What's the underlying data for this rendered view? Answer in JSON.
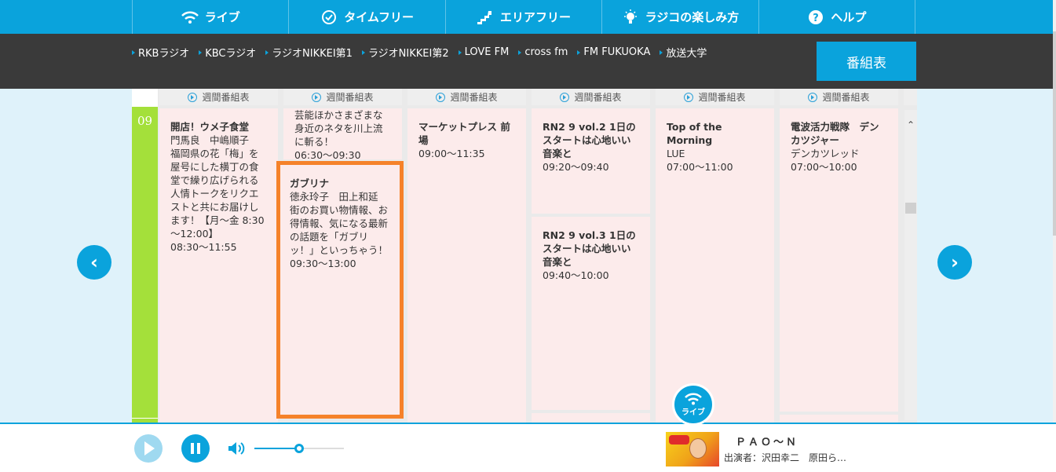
{
  "nav": {
    "items": [
      {
        "label": "ライブ",
        "icon": "wifi-icon"
      },
      {
        "label": "タイムフリー",
        "icon": "check-circle-icon"
      },
      {
        "label": "エリアフリー",
        "icon": "map-icon"
      },
      {
        "label": "ラジコの楽しみ方",
        "icon": "lightbulb-icon"
      },
      {
        "label": "ヘルプ",
        "icon": "help-icon"
      }
    ]
  },
  "stations": [
    "RKBラジオ",
    "KBCラジオ",
    "ラジオNIKKEI第1",
    "ラジオNIKKEI第2",
    "LOVE FM",
    "cross fm",
    "FM FUKUOKA",
    "放送大学"
  ],
  "schedule_button": "番組表",
  "weekly_label": "週間番組表",
  "time": {
    "hour": "09"
  },
  "programs": {
    "c1p1": {
      "title": "開店！ウメ子食堂",
      "desc": "門馬良　中嶋順子　福岡県の花「梅」を屋号にした横丁の食堂で繰り広げられる人情トークをリクエストと共にお届けします！【月～金 8:30～12:00】",
      "time": "08:30～11:55"
    },
    "c2p1": {
      "title": "",
      "desc": "芸能ほかさまざまな身近のネタを川上流に斬る！",
      "time": "06:30～09:30"
    },
    "c2p2": {
      "title": "ガブリナ",
      "desc": "徳永玲子　田上和延　街のお買い物情報、お得情報、気になる最新の話題を「ガブリッ！」といっちゃう！",
      "time": "09:30～13:00"
    },
    "c3p1": {
      "title": "マーケットプレス 前場",
      "desc": "",
      "time": "09:00～11:35"
    },
    "c4p1": {
      "title": "RN2 9 vol.2 1日のスタートは心地いい音楽と",
      "desc": "",
      "time": "09:20～09:40"
    },
    "c4p2": {
      "title": "RN2 9 vol.3 1日のスタートは心地いい音楽と",
      "desc": "",
      "time": "09:40～10:00"
    },
    "c5p1": {
      "title": "Top of the Morning",
      "desc": "LUE",
      "time": "07:00～11:00"
    },
    "c6p1": {
      "title": "電波活力戦隊　デンカツジャー",
      "desc": "デンカツレッド",
      "time": "07:00～10:00"
    }
  },
  "player": {
    "live_label": "ライブ",
    "now_playing_title": "ＰＡＯ～Ｎ",
    "cast": "出演者：沢田幸二　原田ら…",
    "volume_fraction": 0.5
  },
  "colors": {
    "accent": "#0aa3dc",
    "highlight": "#f5822a",
    "time_column": "#a4e03a",
    "program_bg": "#fcebeb"
  }
}
